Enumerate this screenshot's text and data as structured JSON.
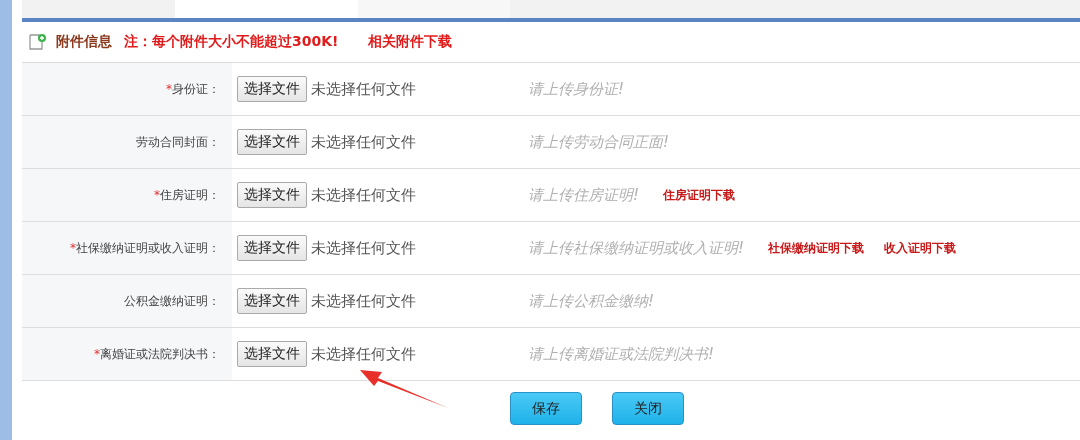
{
  "header": {
    "title": "附件信息",
    "note": "注：每个附件大小不能超过300K!",
    "link": "相关附件下载"
  },
  "rows": [
    {
      "mark": "*",
      "label": "身份证：",
      "button": "选择文件",
      "status": "未选择任何文件",
      "hint": "请上传身份证!",
      "links": []
    },
    {
      "label": "劳动合同封面：",
      "button": "选择文件",
      "status": "未选择任何文件",
      "hint": "请上传劳动合同正面!",
      "links": []
    },
    {
      "mark": "*",
      "label": "住房证明：",
      "button": "选择文件",
      "status": "未选择任何文件",
      "hint": "请上传住房证明!",
      "links": [
        "住房证明下载"
      ]
    },
    {
      "mark": "*",
      "label": "社保缴纳证明或收入证明：",
      "button": "选择文件",
      "status": "未选择任何文件",
      "hint": "请上传社保缴纳证明或收入证明!",
      "links": [
        "社保缴纳证明下载",
        "收入证明下载"
      ]
    },
    {
      "label": "公积金缴纳证明：",
      "button": "选择文件",
      "status": "未选择任何文件",
      "hint": "请上传公积金缴纳!",
      "links": []
    },
    {
      "mark": "*",
      "label": "离婚证或法院判决书：",
      "button": "选择文件",
      "status": "未选择任何文件",
      "hint": "请上传离婚证或法院判决书!",
      "links": []
    }
  ],
  "buttons": [
    "保存",
    "关闭"
  ]
}
